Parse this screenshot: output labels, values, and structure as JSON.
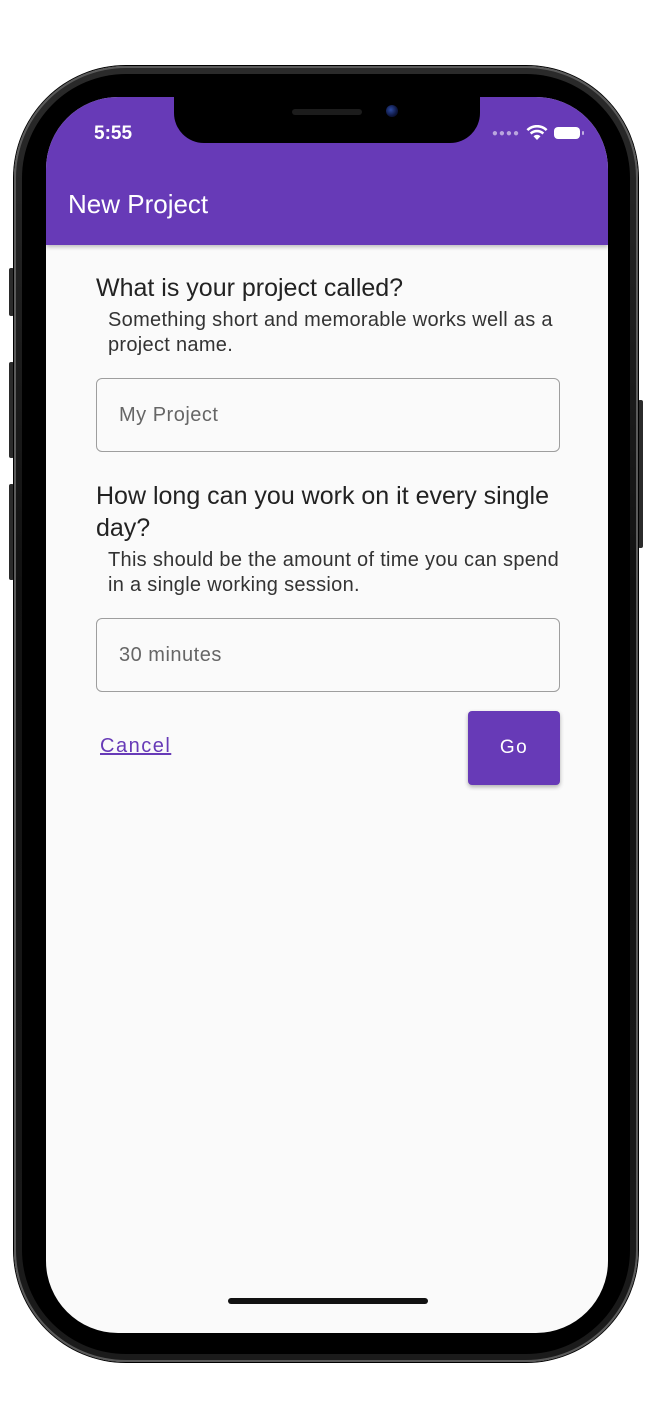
{
  "status_bar": {
    "time": "5:55",
    "signal_icon": "cellular-dots-icon",
    "wifi_icon": "wifi-icon",
    "battery_icon": "battery-icon"
  },
  "app_bar": {
    "title": "New Project",
    "color": "#673ab7"
  },
  "form": {
    "name_question": "What is your project called?",
    "name_hint": "Something short and memorable works well as a project name.",
    "name_placeholder": "My Project",
    "time_question": "How long can you work on it every single day?",
    "time_hint": "This should be the amount of time you can spend in a single working session.",
    "time_placeholder": "30 minutes"
  },
  "actions": {
    "cancel_label": "Cancel",
    "go_label": "Go"
  }
}
